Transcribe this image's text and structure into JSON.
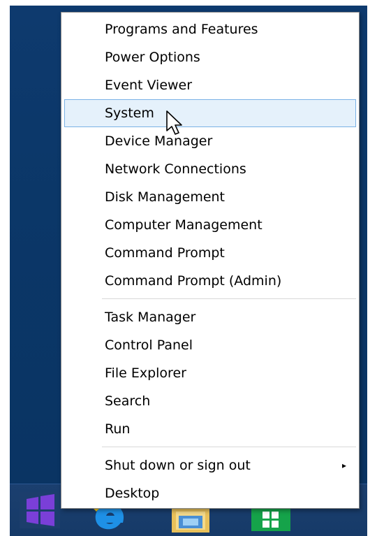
{
  "context_menu": {
    "group1": [
      {
        "label": "Programs and Features"
      },
      {
        "label": "Power Options"
      },
      {
        "label": "Event Viewer"
      },
      {
        "label": "System"
      },
      {
        "label": "Device Manager"
      },
      {
        "label": "Network Connections"
      },
      {
        "label": "Disk Management"
      },
      {
        "label": "Computer Management"
      },
      {
        "label": "Command Prompt"
      },
      {
        "label": "Command Prompt (Admin)"
      }
    ],
    "group2": [
      {
        "label": "Task Manager"
      },
      {
        "label": "Control Panel"
      },
      {
        "label": "File Explorer"
      },
      {
        "label": "Search"
      },
      {
        "label": "Run"
      }
    ],
    "group3": [
      {
        "label": "Shut down or sign out",
        "submenu_arrow": "▸"
      },
      {
        "label": "Desktop"
      }
    ],
    "hovered_item": "System"
  },
  "taskbar": {
    "start_icon": "windows-logo-icon",
    "apps": [
      "internet-explorer-icon",
      "file-explorer-icon",
      "store-icon"
    ]
  },
  "colors": {
    "hover_bg": "#e5f1fb",
    "hover_border": "#7ab2e6",
    "start_purple": "#6b2fbd",
    "taskbar": "#163a68"
  }
}
